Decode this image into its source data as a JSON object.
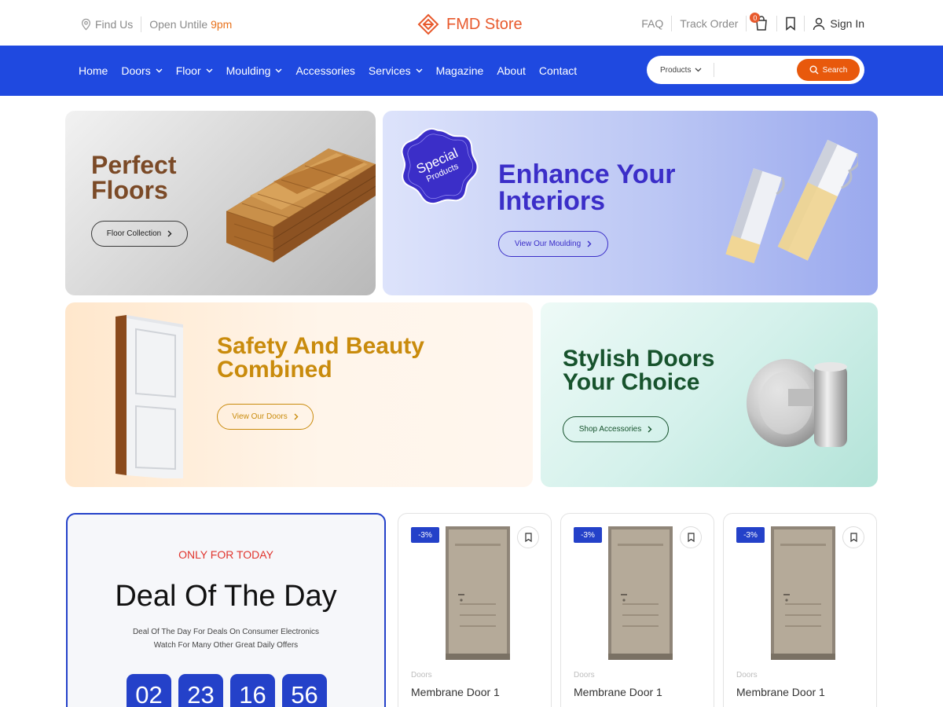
{
  "topbar": {
    "find_us": "Find Us",
    "open_prefix": "Open Untile",
    "open_time": "9pm",
    "brand": "FMD Store",
    "faq": "FAQ",
    "track_order": "Track Order",
    "cart_count": "0",
    "sign_in": "Sign In"
  },
  "nav": {
    "items": [
      "Home",
      "Doors",
      "Floor",
      "Moulding",
      "Accessories",
      "Services",
      "Magazine",
      "About",
      "Contact"
    ],
    "search_category": "Products",
    "search_placeholder": "",
    "search_button": "Search"
  },
  "banners": [
    {
      "title_l1": "Perfect",
      "title_l2": "Floors",
      "button": "Floor Collection"
    },
    {
      "title_l1": "Enhance Your",
      "title_l2": "Interiors",
      "button": "View Our Moulding",
      "seal_l1": "Special",
      "seal_l2": "Products"
    },
    {
      "title_l1": "Safety And Beauty",
      "title_l2": "Combined",
      "button": "View Our Doors"
    },
    {
      "title_l1": "Stylish Doors",
      "title_l2": "Your Choice",
      "button": "Shop Accessories"
    }
  ],
  "deal": {
    "tag": "ONLY FOR TODAY",
    "title": "Deal Of The Day",
    "sub_l1": "Deal Of The Day For Deals On Consumer Electronics",
    "sub_l2": "Watch For Many Other Great Daily Offers",
    "timer": [
      "02",
      "23",
      "16",
      "56"
    ]
  },
  "products": [
    {
      "discount": "-3%",
      "category": "Doors",
      "name": "Membrane Door 1"
    },
    {
      "discount": "-3%",
      "category": "Doors",
      "name": "Membrane Door 1"
    },
    {
      "discount": "-3%",
      "category": "Doors",
      "name": "Membrane Door 1"
    }
  ],
  "colors": {
    "nav_blue": "#1f49e0",
    "accent_orange": "#e8592c",
    "deal_blue": "#2441c9"
  }
}
